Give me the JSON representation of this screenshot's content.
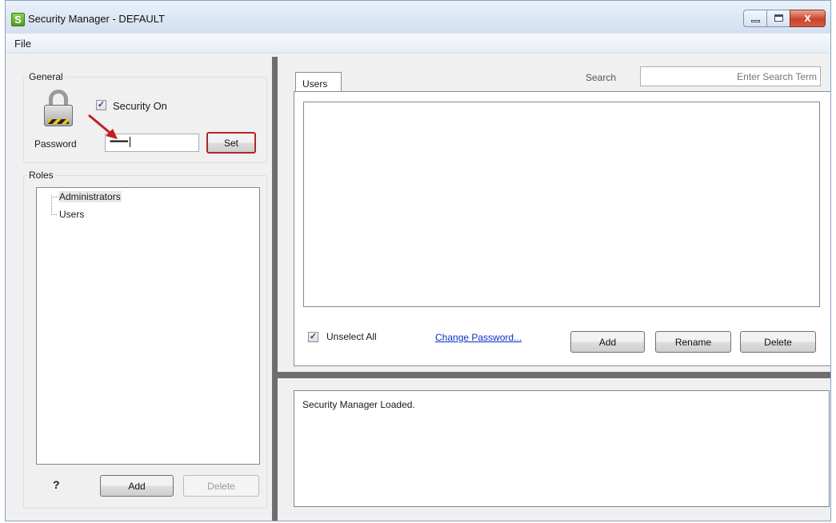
{
  "window": {
    "title": "Security Manager - DEFAULT",
    "app_icon_letter": "S",
    "close_glyph": "x"
  },
  "menu": {
    "file": "File"
  },
  "general": {
    "legend": "General",
    "security_on_label": "Security On",
    "security_on_checked": true,
    "password_label": "Password",
    "password_value": "•••••••••",
    "set_button": "Set"
  },
  "roles": {
    "legend": "Roles",
    "items": [
      "Administrators",
      "Users"
    ],
    "help_glyph": "?",
    "add_button": "Add",
    "delete_button": "Delete"
  },
  "users_tab": {
    "tab_label": "Users",
    "search_label": "Search",
    "search_placeholder": "Enter Search Term",
    "unselect_all_label": "Unselect All",
    "unselect_all_checked": true,
    "change_password_link": "Change Password...",
    "add_button": "Add",
    "rename_button": "Rename",
    "delete_button": "Delete"
  },
  "log": {
    "message": "Security Manager Loaded."
  },
  "colors": {
    "accent_red": "#b0282a",
    "link_blue": "#0a2fbf",
    "splitter": "#6e6e6e"
  }
}
